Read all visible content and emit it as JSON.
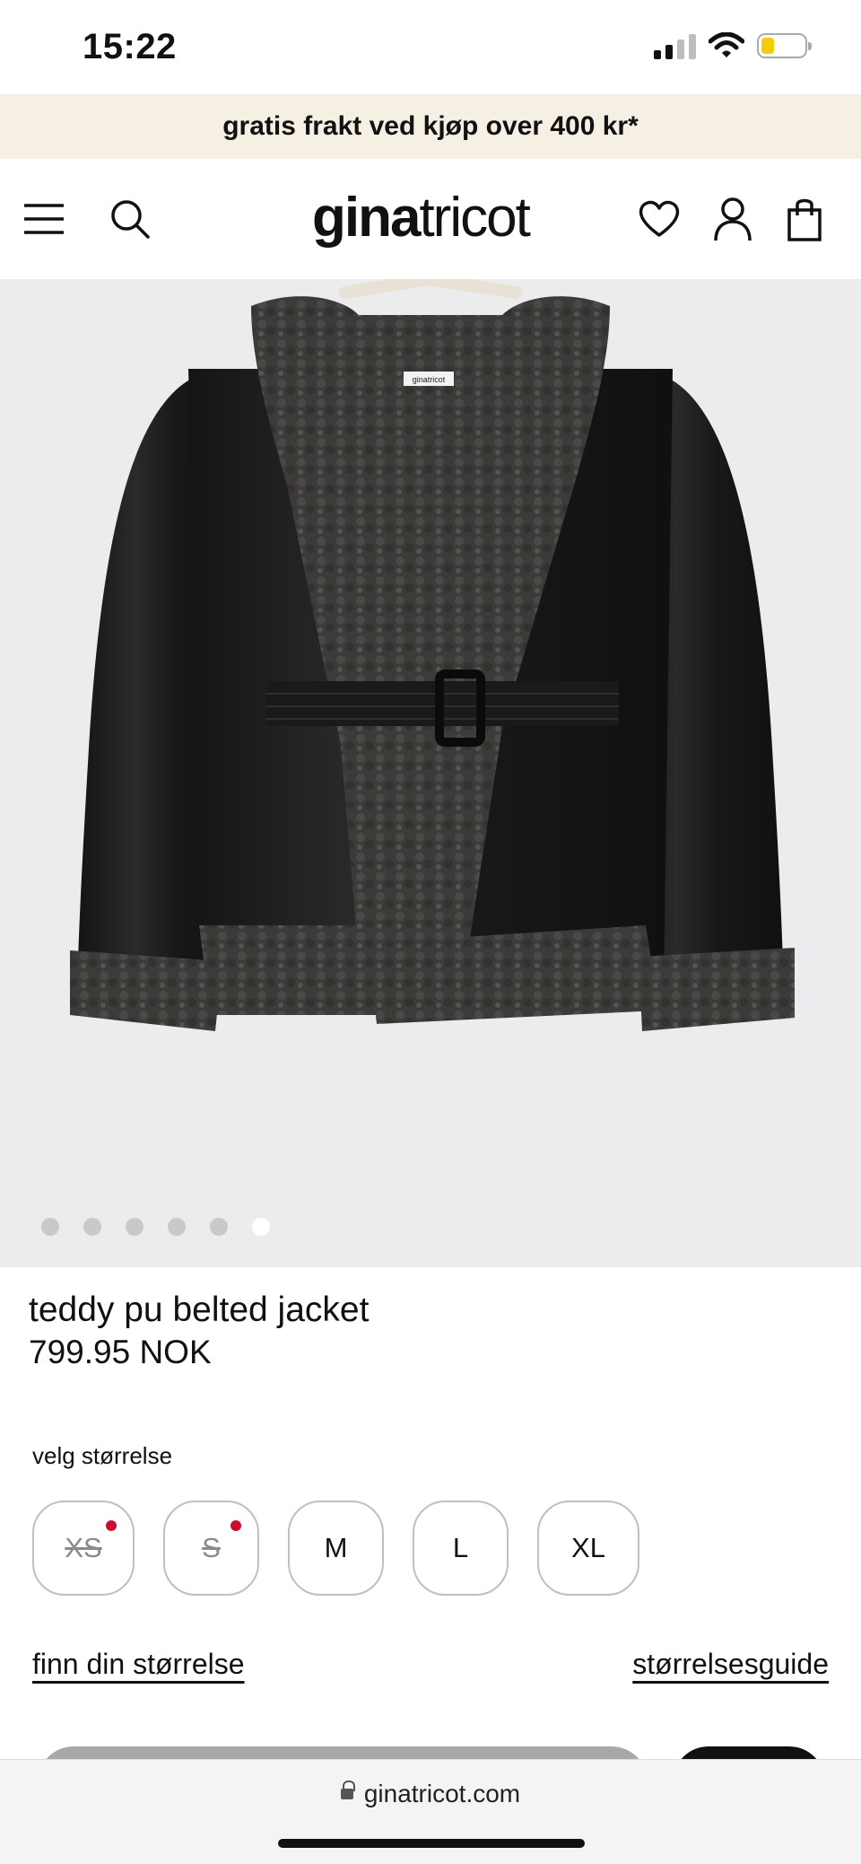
{
  "status_bar": {
    "time": "15:22",
    "battery_level": 0.2,
    "signal_bars": 2
  },
  "promo": {
    "text": "gratis frakt ved kjøp over 400 kr*"
  },
  "header": {
    "logo_bold": "gina",
    "logo_light": "tricot",
    "icons": [
      "menu-icon",
      "search-icon",
      "heart-icon",
      "user-icon",
      "bag-icon"
    ]
  },
  "gallery": {
    "image_count": 6,
    "active_index": 5
  },
  "product": {
    "name": "teddy pu belted jacket",
    "price": "799.95 NOK",
    "hanger_label": "ginatricot"
  },
  "size_selector": {
    "label": "velg størrelse",
    "sizes": [
      {
        "label": "XS",
        "available": false
      },
      {
        "label": "S",
        "available": false
      },
      {
        "label": "M",
        "available": true
      },
      {
        "label": "L",
        "available": true
      },
      {
        "label": "XL",
        "available": true
      }
    ]
  },
  "links": {
    "find_size": "finn din størrelse",
    "size_guide": "størrelsesguide"
  },
  "browser": {
    "url": "ginatricot.com"
  },
  "colors": {
    "promo_bg": "#f6f0e4",
    "sold_out_dot": "#c8102e",
    "battery_fill": "#f5cc00"
  }
}
